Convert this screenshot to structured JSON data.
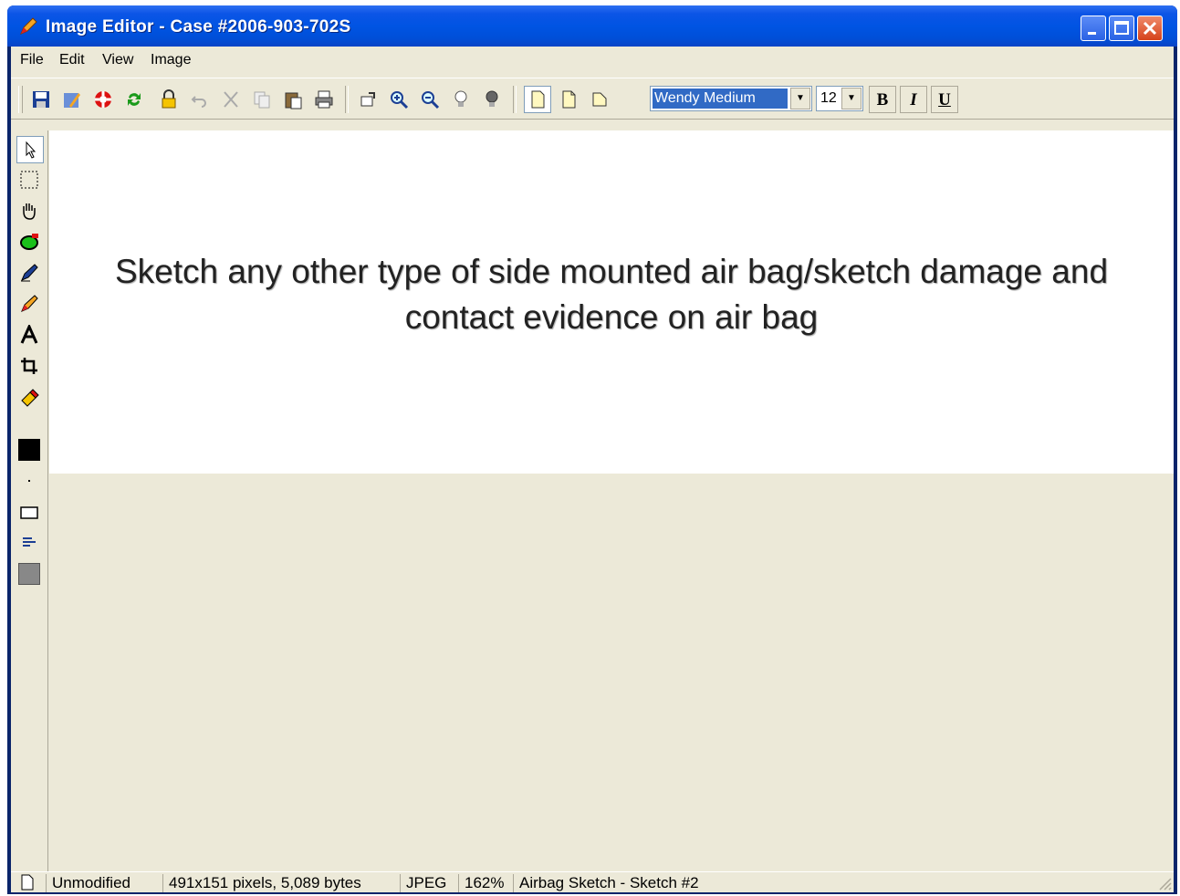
{
  "window": {
    "title": "Image Editor - Case #2006-903-702S"
  },
  "menu": {
    "items": [
      "File",
      "Edit",
      "View",
      "Image"
    ]
  },
  "toolbar": {
    "font_name": "Wendy Medium",
    "font_size": "12",
    "bold_label": "B",
    "italic_label": "I",
    "underline_label": "U"
  },
  "canvas": {
    "line1": "Sketch any other type of side mounted air bag/sketch damage and",
    "line2": "contact evidence on air bag"
  },
  "status": {
    "modified": "Unmodified",
    "dimensions": "491x151 pixels, 5,089 bytes",
    "format": "JPEG",
    "zoom": "162%",
    "sketch_name": "Airbag Sketch - Sketch #2"
  },
  "colors": {
    "title_blue": "#0054e3",
    "chrome": "#ece9d8",
    "selection": "#316ac5"
  }
}
